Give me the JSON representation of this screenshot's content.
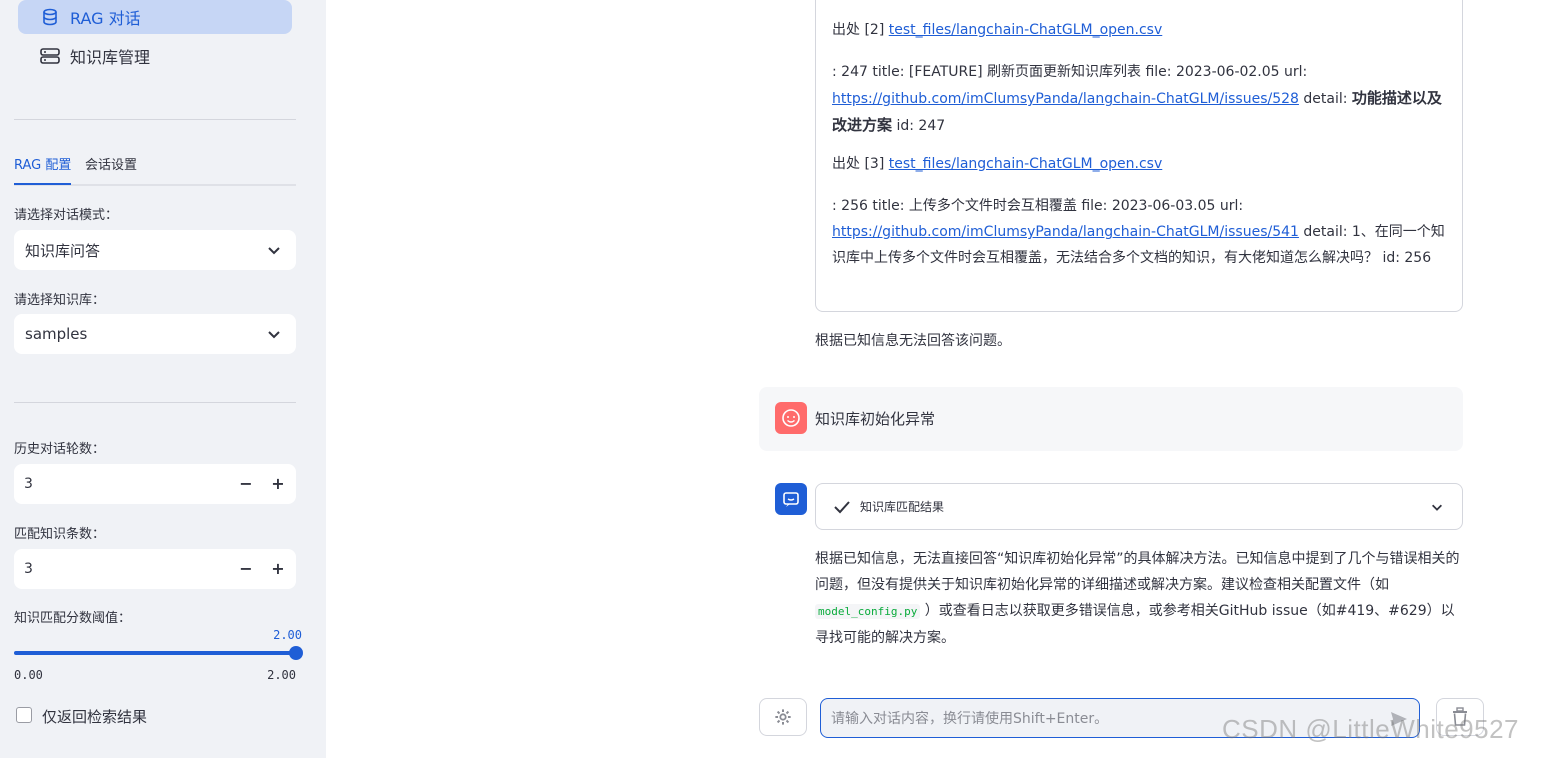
{
  "sidebar": {
    "nav": [
      {
        "label": "RAG 对话",
        "icon": "database-icon",
        "active": true
      },
      {
        "label": "知识库管理",
        "icon": "server-icon",
        "active": false
      }
    ],
    "tabs": [
      {
        "label": "RAG 配置",
        "active": true
      },
      {
        "label": "会话设置",
        "active": false
      }
    ],
    "mode_label": "请选择对话模式：",
    "mode_value": "知识库问答",
    "kb_label": "请选择知识库：",
    "kb_value": "samples",
    "history_label": "历史对话轮数：",
    "history_value": "3",
    "match_count_label": "匹配知识条数：",
    "match_count_value": "3",
    "threshold_label": "知识匹配分数阈值：",
    "threshold_value": "2.00",
    "threshold_min": "0.00",
    "threshold_max": "2.00",
    "threshold_fraction": 1.0,
    "checkbox_label": "仅返回检索结果",
    "minus": "−",
    "plus": "+"
  },
  "references": {
    "ref2_prefix": "出处 [2]",
    "ref2_link": "test_files/langchain-ChatGLM_open.csv",
    "ref2_body": ": 247 title: [FEATURE] 刷新页面更新知识库列表 file: 2023-06-02.05 url:",
    "ref2_url": "https://github.com/imClumsyPanda/langchain-ChatGLM/issues/528",
    "ref2_detail_label": " detail: ",
    "ref2_detail_bold": "功能描述以及改进方案",
    "ref2_id": " id: 247",
    "ref3_prefix": "出处 [3]",
    "ref3_link": "test_files/langchain-ChatGLM_open.csv",
    "ref3_body": ": 256 title: 上传多个文件时会互相覆盖 file: 2023-06-03.05 url:",
    "ref3_url": "https://github.com/imClumsyPanda/langchain-ChatGLM/issues/541",
    "ref3_detail": " detail: 1、在同一个知识库中上传多个文件时会互相覆盖，无法结合多个文档的知识，有大佬知道怎么解决吗？ id: 256"
  },
  "first_answer": "根据已知信息无法回答该问题。",
  "user_message": "知识库初始化异常",
  "expander_label": "知识库匹配结果",
  "second_answer": {
    "part1": "根据已知信息，无法直接回答“知识库初始化异常”的具体解决方法。已知信息中提到了几个与错误相关的问题，但没有提供关于知识库初始化异常的详细描述或解决方案。建议检查相关配置文件（如 ",
    "code": "model_config.py",
    "part2": " ）或查看日志以获取更多错误信息，或参考相关GitHub issue（如#419、#629）以寻找可能的解决方案。"
  },
  "chat_input": {
    "placeholder": "请输入对话内容，换行请使用Shift+Enter。"
  },
  "watermark": "CSDN @LittleWhite9527",
  "colors": {
    "accent": "#1f5ed6",
    "user_avatar": "#ff6b6b",
    "sidebar_bg": "#f0f2f6"
  }
}
